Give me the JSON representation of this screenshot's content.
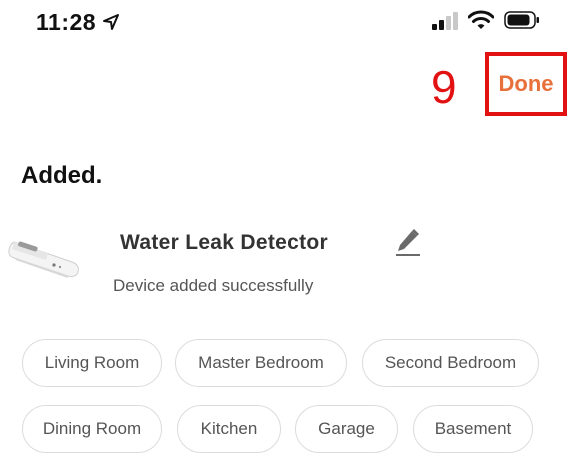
{
  "status_bar": {
    "time": "11:28",
    "icons": [
      "location-arrow-icon",
      "cellular-signal-icon",
      "wifi-icon",
      "battery-icon"
    ]
  },
  "header": {
    "annotation_number": "9",
    "done_label": "Done"
  },
  "main": {
    "title": "Added.",
    "device": {
      "name": "Water Leak Detector",
      "status": "Device added successfully",
      "icon": "edit-pencil-icon"
    },
    "rooms": [
      "Living Room",
      "Master Bedroom",
      "Second Bedroom",
      "Dining Room",
      "Kitchen",
      "Garage",
      "Basement"
    ]
  },
  "colors": {
    "accent": "#e8703a",
    "annotation": "#e31212",
    "chip_border": "#dcdcdc"
  }
}
